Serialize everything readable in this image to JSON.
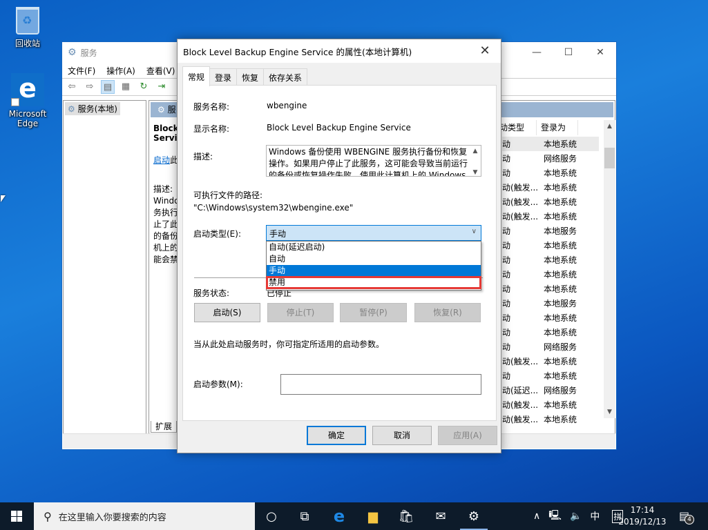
{
  "desktop": {
    "icons": [
      {
        "label": "回收站",
        "icon": "recycle-bin-icon"
      },
      {
        "label_line1": "Microsoft",
        "label_line2": "Edge",
        "icon": "edge-icon"
      }
    ]
  },
  "services_window": {
    "title": "服务",
    "controls": {
      "minimize": "—",
      "maximize": "☐",
      "close": "✕"
    },
    "menu": [
      "文件(F)",
      "操作(A)",
      "查看(V)"
    ],
    "tree_item": "服务(本地)",
    "left_pane": {
      "header": "服",
      "service_name_line1": "Block",
      "service_name_line2": "Servic",
      "start_link": "启动",
      "start_link_suffix": "此",
      "desc_label": "描述:",
      "desc_lines": [
        "Windo",
        "务执行",
        "止了此",
        "的备份",
        "机上的",
        "能会禁"
      ]
    },
    "list_headers": [
      "动类型",
      "登录为"
    ],
    "rows": [
      {
        "startup": "动",
        "logon": "本地系统"
      },
      {
        "startup": "动",
        "logon": "网络服务"
      },
      {
        "startup": "动",
        "logon": "本地系统"
      },
      {
        "startup": "动(触发...",
        "logon": "本地系统"
      },
      {
        "startup": "动(触发...",
        "logon": "本地系统"
      },
      {
        "startup": "动(触发...",
        "logon": "本地系统"
      },
      {
        "startup": "动",
        "logon": "本地服务"
      },
      {
        "startup": "动",
        "logon": "本地系统"
      },
      {
        "startup": "动",
        "logon": "本地系统"
      },
      {
        "startup": "动",
        "logon": "本地系统"
      },
      {
        "startup": "动",
        "logon": "本地系统"
      },
      {
        "startup": "动",
        "logon": "本地服务"
      },
      {
        "startup": "动",
        "logon": "本地系统"
      },
      {
        "startup": "动",
        "logon": "本地系统"
      },
      {
        "startup": "动",
        "logon": "网络服务"
      },
      {
        "startup": "动(触发...",
        "logon": "本地系统"
      },
      {
        "startup": "动",
        "logon": "本地系统"
      },
      {
        "startup": "动(延迟...",
        "logon": "网络服务"
      },
      {
        "startup": "动(触发...",
        "logon": "本地系统"
      },
      {
        "startup": "动(触发...",
        "logon": "本地系统"
      }
    ],
    "bottom_tab": "扩展"
  },
  "dialog": {
    "title": "Block Level Backup Engine Service 的属性(本地计算机)",
    "close": "✕",
    "tabs": [
      "常规",
      "登录",
      "恢复",
      "依存关系"
    ],
    "service_name_label": "服务名称:",
    "service_name": "wbengine",
    "display_name_label": "显示名称:",
    "display_name": "Block Level Backup Engine Service",
    "description_label": "描述:",
    "description": "Windows 备份使用 WBENGINE 服务执行备份和恢复操作。如果用户停止了此服务，这可能会导致当前运行的备份或恢复操作失败。使用此计算机上的 Windows",
    "path_label": "可执行文件的路径:",
    "path": "\"C:\\Windows\\system32\\wbengine.exe\"",
    "startup_type_label": "启动类型(E):",
    "startup_type_value": "手动",
    "startup_options": [
      "自动(延迟启动)",
      "自动",
      "手动",
      "禁用"
    ],
    "selected_option": "手动",
    "highlighted_option": "禁用",
    "status_label": "服务状态:",
    "status_value": "已停止",
    "buttons": {
      "start": "启动(S)",
      "stop": "停止(T)",
      "pause": "暂停(P)",
      "resume": "恢复(R)"
    },
    "hint": "当从此处启动服务时，你可指定所适用的启动参数。",
    "param_label": "启动参数(M):",
    "param_value": "",
    "ok": "确定",
    "cancel": "取消",
    "apply": "应用(A)"
  },
  "taskbar": {
    "search_placeholder": "在这里输入你要搜索的内容",
    "ime": "中",
    "ime_mode": "拼",
    "time": "17:14",
    "date": "2019/12/13",
    "notification_count": "4"
  }
}
